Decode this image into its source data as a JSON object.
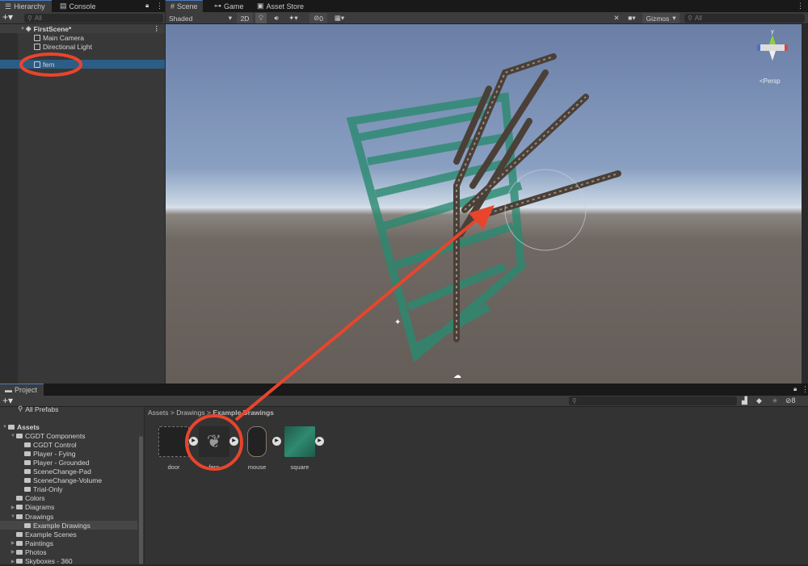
{
  "hierarchy": {
    "tabs": [
      {
        "label": "Hierarchy",
        "icon": "list-icon"
      },
      {
        "label": "Console",
        "icon": "console-icon"
      }
    ],
    "search_placeholder": "All",
    "scene_name": "FirstScene*",
    "items": [
      {
        "label": "Main Camera"
      },
      {
        "label": "Directional Light"
      },
      {
        "label": "fern",
        "selected": true
      }
    ]
  },
  "scene": {
    "tabs": [
      {
        "label": "Scene",
        "icon": "grid-icon"
      },
      {
        "label": "Game",
        "icon": "gamepad-icon"
      },
      {
        "label": "Asset Store",
        "icon": "bag-icon"
      }
    ],
    "draw_mode": "Shaded",
    "mode_2d": "2D",
    "hidden_count": "0",
    "gizmos_label": "Gizmos",
    "search_placeholder": "All",
    "gizmo_axis": "y",
    "projection": "Persp"
  },
  "project": {
    "tab": "Project",
    "favorites": [
      {
        "label": "All Prefabs"
      }
    ],
    "tree": [
      {
        "label": "Assets",
        "depth": 0,
        "expanded": true,
        "bold": true
      },
      {
        "label": "CGDT Components",
        "depth": 1,
        "expanded": true
      },
      {
        "label": "CGDT Control",
        "depth": 2
      },
      {
        "label": "Player - Fying",
        "depth": 2
      },
      {
        "label": "Player - Grounded",
        "depth": 2
      },
      {
        "label": "SceneChange-Pad",
        "depth": 2
      },
      {
        "label": "SceneChange-Volume",
        "depth": 2
      },
      {
        "label": "Trial-Only",
        "depth": 2
      },
      {
        "label": "Colors",
        "depth": 1
      },
      {
        "label": "Diagrams",
        "depth": 1,
        "collapsed": true
      },
      {
        "label": "Drawings",
        "depth": 1,
        "expanded": true
      },
      {
        "label": "Example Drawings",
        "depth": 2,
        "selected": true
      },
      {
        "label": "Example Scenes",
        "depth": 1
      },
      {
        "label": "Paintings",
        "depth": 1,
        "collapsed": true
      },
      {
        "label": "Photos",
        "depth": 1,
        "collapsed": true
      },
      {
        "label": "Skyboxes - 360",
        "depth": 1,
        "collapsed": true
      }
    ],
    "breadcrumb": [
      "Assets",
      "Drawings",
      "Example Drawings"
    ],
    "assets": [
      {
        "label": "door"
      },
      {
        "label": "fern"
      },
      {
        "label": "mouse"
      },
      {
        "label": "square"
      }
    ],
    "hidden_count": "8"
  },
  "annotation_color": "#e8452c"
}
